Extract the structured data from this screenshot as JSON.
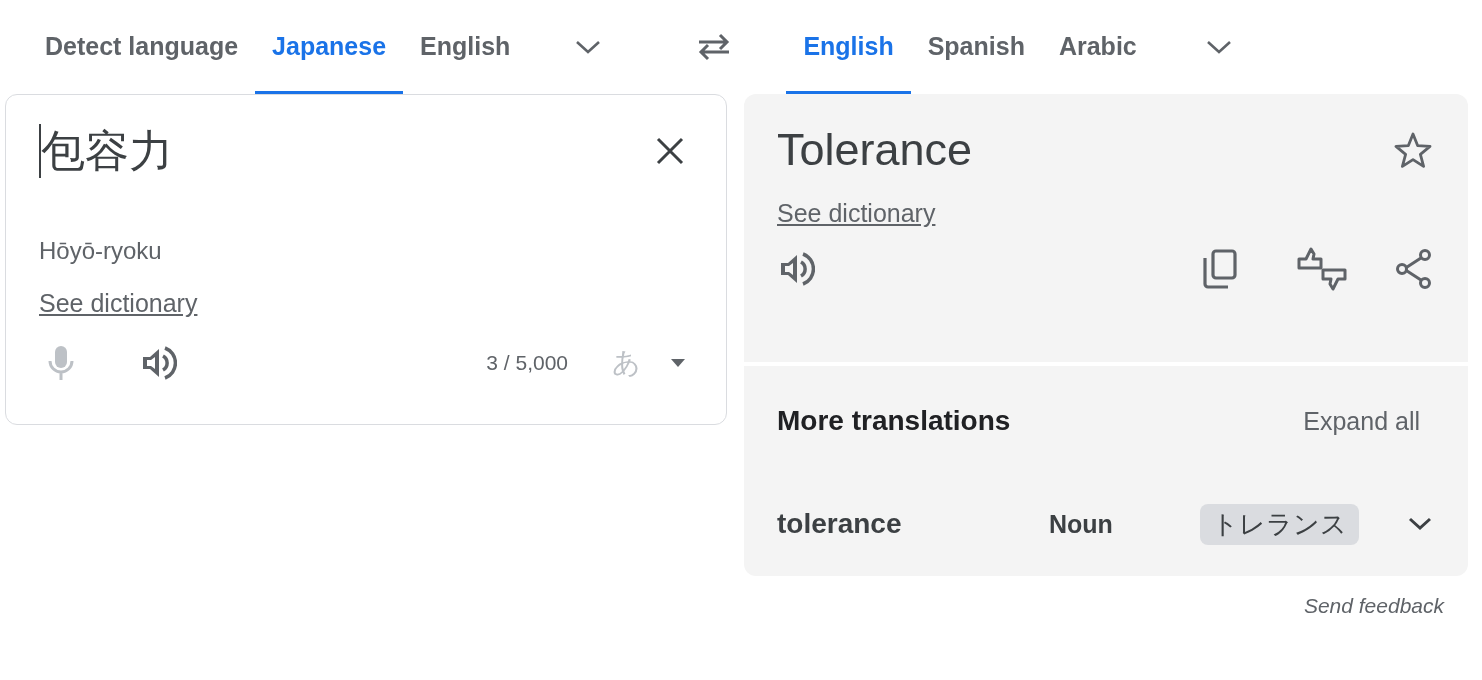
{
  "source_tabs": [
    {
      "label": "Detect language",
      "selected": false
    },
    {
      "label": "Japanese",
      "selected": true
    },
    {
      "label": "English",
      "selected": false
    }
  ],
  "target_tabs": [
    {
      "label": "English",
      "selected": true
    },
    {
      "label": "Spanish",
      "selected": false
    },
    {
      "label": "Arabic",
      "selected": false
    }
  ],
  "source": {
    "text": "包容力",
    "romanization": "Hōyō-ryoku",
    "dictionary_link": "See dictionary",
    "mic_disabled": true,
    "char_count": "3 / 5,000",
    "input_tool": "あ",
    "input_tool_disabled": true
  },
  "target": {
    "text": "Tolerance",
    "dictionary_link": "See dictionary"
  },
  "more_translations": {
    "title": "More translations",
    "expand_label": "Expand all",
    "rows": [
      {
        "word": "tolerance",
        "part_of_speech": "Noun",
        "back_translation": "トレランス"
      }
    ]
  },
  "feedback": "Send feedback"
}
